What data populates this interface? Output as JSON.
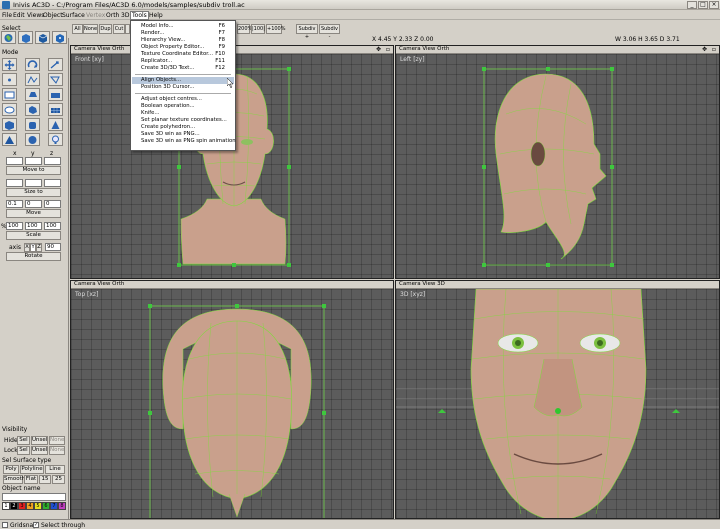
{
  "window": {
    "title": "Inivis AC3D - C:/Program Files/AC3D 6.0/models/samples/subdiv troll.ac",
    "controls": [
      "_",
      "□",
      "×"
    ]
  },
  "menubar": {
    "items": [
      "File",
      "Edit",
      "Views",
      "Object",
      "Surface",
      "Vertex",
      "Orth",
      "3D",
      "Tools",
      "Help"
    ],
    "active": "Tools",
    "disabled": "Vertex"
  },
  "toolbar": {
    "buttons": [
      "All",
      "None",
      "Dup",
      "Cut",
      "Cop",
      "Subdiv +",
      "Subdiv -"
    ],
    "zoom": [
      "200%",
      "|100|",
      "+100%"
    ],
    "coord_left": "X 4.45 Y 2.33 Z 0.00",
    "coord_right": "W 3.06 H 3.65 D 3.71"
  },
  "tools_menu": {
    "items": [
      {
        "label": "Model Info...",
        "shortcut": "F6"
      },
      {
        "label": "Render...",
        "shortcut": "F7"
      },
      {
        "label": "Hierarchy View...",
        "shortcut": "F8"
      },
      {
        "label": "Object Property Editor...",
        "shortcut": "F9"
      },
      {
        "label": "Texture Coordinate Editor...",
        "shortcut": "F10"
      },
      {
        "label": "Replicator...",
        "shortcut": "F11"
      },
      {
        "label": "Create 3D/3D Text...",
        "shortcut": "F12"
      },
      {
        "label": "Align Objects...",
        "shortcut": ""
      },
      {
        "label": "Position 3D Cursor...",
        "shortcut": ""
      },
      {
        "label": "Adjust object centres...",
        "shortcut": ""
      },
      {
        "label": "Boolean operation...",
        "shortcut": ""
      },
      {
        "label": "Knife...",
        "shortcut": ""
      },
      {
        "label": "Set planar texture coordinates...",
        "shortcut": ""
      },
      {
        "label": "Create polyhedron...",
        "shortcut": ""
      },
      {
        "label": "Save 3D win as PNG...",
        "shortcut": ""
      },
      {
        "label": "Save 3D win as PNG spin animation",
        "shortcut": ""
      }
    ],
    "highlighted": "Align Objects..."
  },
  "left_panel": {
    "select_label": "Select",
    "mode_label": "Mode",
    "axis_headers": [
      "x",
      "y",
      "z"
    ],
    "move_to_label": "Move to",
    "size_to_label": "Size to",
    "move_fields": [
      "0.1",
      "0",
      "0"
    ],
    "move_label": "Move",
    "scale_fields": [
      "100",
      "100",
      "100"
    ],
    "scale_axis_label": "%",
    "scale_label": "Scale",
    "axis_label": "axis",
    "axis_buttons": [
      "X",
      "Y",
      "Z"
    ],
    "rotate_value": "90",
    "rotate_label": "Rotate",
    "visibility_label": "Visibility",
    "hide_row": [
      "Hide:",
      "Sel",
      "Unsel",
      "None"
    ],
    "lock_row": [
      "Lock:",
      "Sel",
      "Unsel",
      "None"
    ],
    "surface_type_label": "Sel Surface type",
    "surface_row1": [
      "Poly",
      "Polyline",
      "Line"
    ],
    "surface_row2": [
      "Smooth",
      "Flat",
      "15",
      "25"
    ],
    "object_name_label": "Object name",
    "palette": [
      "1",
      "2",
      "3",
      "4",
      "5",
      "6",
      "7",
      "8"
    ],
    "palette_colors": [
      "#ffffff",
      "#000000",
      "#e02020",
      "#f0a020",
      "#e8e020",
      "#30b030",
      "#2050d0",
      "#c040c0"
    ]
  },
  "viewports": {
    "front": {
      "header": "Camera View Orth",
      "label": "Front [xy]"
    },
    "left": {
      "header": "Camera View Orth",
      "label": "Left [zy]"
    },
    "top": {
      "header": "Camera View Orth",
      "label": "Top [xz]"
    },
    "persp": {
      "header": "Camera View 3D",
      "label": "3D [xyz]"
    }
  },
  "statusbar": {
    "gridsnap": "Gridsnap",
    "select_through": "Select through"
  },
  "colors": {
    "skin": "#c9a08c",
    "wire": "#7ddc3a",
    "viewport_bg": "#5c5c5c",
    "handle": "#3ec83e"
  }
}
